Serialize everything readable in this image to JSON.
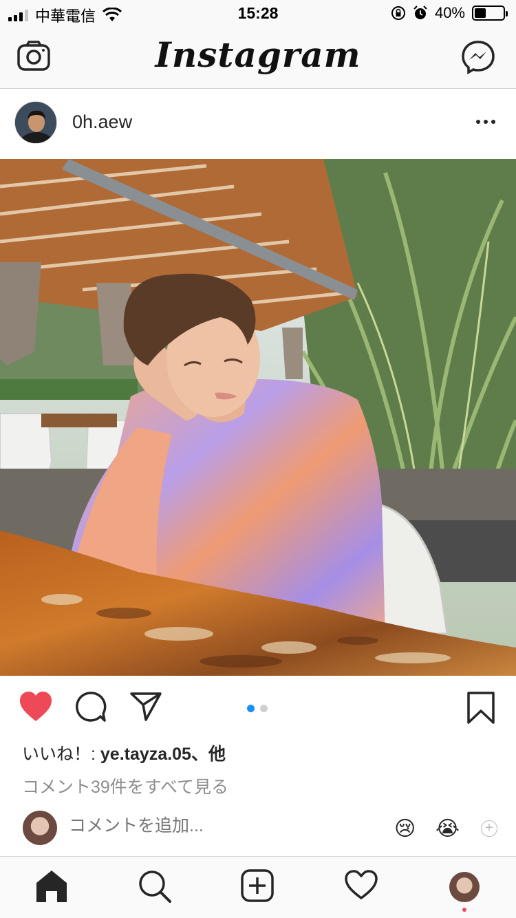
{
  "status_bar": {
    "carrier": "中華電信",
    "time": "15:28",
    "battery": "40%",
    "battery_level": 0.4
  },
  "header": {
    "title": "Instagram",
    "left_icon": "camera-icon",
    "right_icon": "messenger-icon"
  },
  "post": {
    "username": "0h.aew",
    "image_count": 2,
    "current_image": 1,
    "liked": true,
    "likes_prefix": "いいね！: ",
    "likes_user": "ye.tayza.05",
    "likes_suffix": "、他",
    "view_comments": "コメント39件をすべて見る",
    "comment_placeholder": "コメントを追加...",
    "quick_emojis": [
      "😢",
      "😭"
    ]
  },
  "colors": {
    "like": "#ed4956",
    "accent": "#1a8ff5",
    "text": "#262626",
    "muted": "#8e8e8e"
  },
  "tab_bar": [
    "home-icon",
    "search-icon",
    "new-post-icon",
    "activity-icon",
    "profile-avatar"
  ]
}
